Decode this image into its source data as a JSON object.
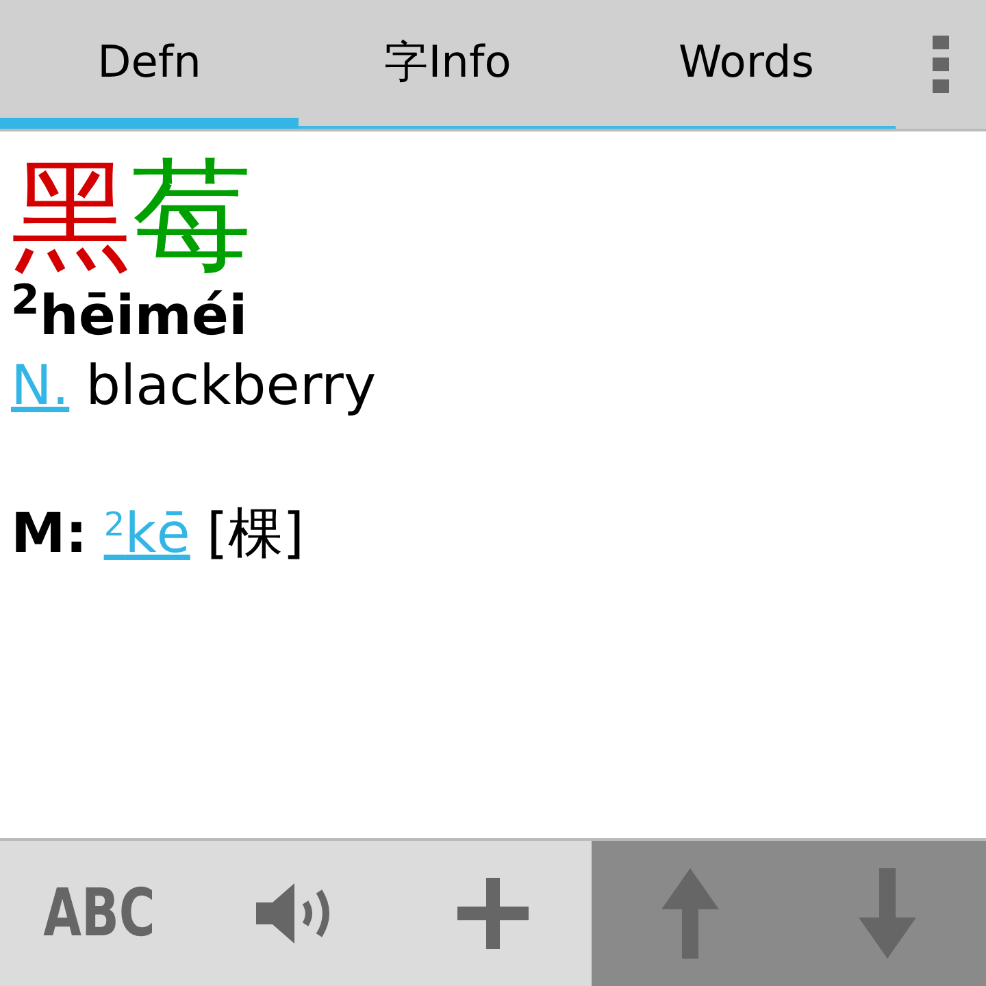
{
  "tabs": [
    {
      "label": "Defn",
      "selected": true
    },
    {
      "label": "字Info",
      "selected": false
    },
    {
      "label": "Words",
      "selected": false
    }
  ],
  "entry": {
    "characters": [
      {
        "char": "黑",
        "color": "#d40000"
      },
      {
        "char": "莓",
        "color": "#00a000"
      }
    ],
    "pinyin": "$^{2}$hēiméi",
    "definitions": [
      {
        "pos": "N.",
        "text": "blackberry"
      }
    ],
    "measure": {
      "label": "M:",
      "tone": "2",
      "pinyin": "kē",
      "hanzi": "[棵]"
    }
  },
  "toolbar": [
    {
      "kind": "text",
      "label": "ABC"
    },
    {
      "kind": "speaker"
    },
    {
      "kind": "plus"
    }
  ],
  "nav": [
    {
      "kind": "up"
    },
    {
      "kind": "down"
    }
  ]
}
